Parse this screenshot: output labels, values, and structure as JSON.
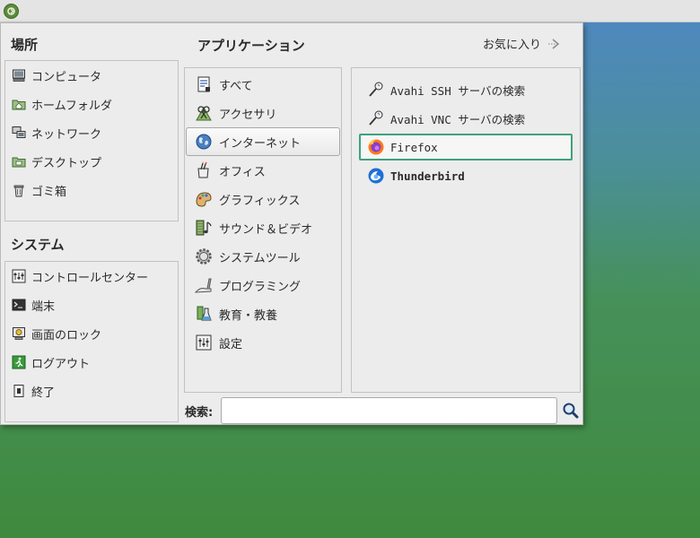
{
  "window": {
    "places_title": "場所",
    "system_title": "システム",
    "applications_title": "アプリケーション",
    "favorites_label": "お気に入り",
    "search_label": "検索:",
    "search_value": ""
  },
  "places": [
    {
      "label": "コンピュータ",
      "icon": "computer-icon"
    },
    {
      "label": "ホームフォルダ",
      "icon": "home-folder-icon"
    },
    {
      "label": "ネットワーク",
      "icon": "network-icon"
    },
    {
      "label": "デスクトップ",
      "icon": "desktop-folder-icon"
    },
    {
      "label": "ゴミ箱",
      "icon": "trash-icon"
    }
  ],
  "system": [
    {
      "label": "コントロールセンター",
      "icon": "control-center-icon"
    },
    {
      "label": "端末",
      "icon": "terminal-icon"
    },
    {
      "label": "画面のロック",
      "icon": "lock-screen-icon"
    },
    {
      "label": "ログアウト",
      "icon": "logout-icon"
    },
    {
      "label": "終了",
      "icon": "shutdown-icon"
    }
  ],
  "categories": [
    {
      "label": "すべて",
      "icon": "all-apps-icon"
    },
    {
      "label": "アクセサリ",
      "icon": "accessories-icon"
    },
    {
      "label": "インターネット",
      "icon": "internet-globe-icon",
      "selected": true
    },
    {
      "label": "オフィス",
      "icon": "office-icon"
    },
    {
      "label": "グラフィックス",
      "icon": "graphics-icon"
    },
    {
      "label": "サウンド＆ビデオ",
      "icon": "sound-video-icon"
    },
    {
      "label": "システムツール",
      "icon": "system-tools-icon"
    },
    {
      "label": "プログラミング",
      "icon": "programming-icon"
    },
    {
      "label": "教育・教養",
      "icon": "education-icon"
    },
    {
      "label": "設定",
      "icon": "settings-icon"
    }
  ],
  "apps": [
    {
      "label": "Avahi SSH サーバの検索",
      "icon": "avahi-ssh-icon"
    },
    {
      "label": "Avahi VNC サーバの検索",
      "icon": "avahi-vnc-icon"
    },
    {
      "label": "Firefox",
      "icon": "firefox-icon",
      "focused": true
    },
    {
      "label": "Thunderbird",
      "icon": "thunderbird-icon",
      "bold": true
    }
  ],
  "colors": {
    "focus_border": "#3ea27a",
    "desktop_top": "#4f87c4",
    "desktop_bottom": "#3f8a3e"
  }
}
